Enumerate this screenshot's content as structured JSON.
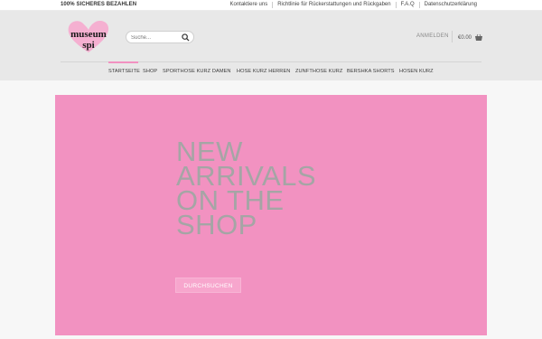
{
  "topbar": {
    "secure_text": "100% SICHERES BEZAHLEN",
    "links": [
      "Kontaktiere uns",
      "Richtlinie für Rückerstattungen und Rückgaben",
      "F.A.Q",
      "Datenschutzerklärung"
    ]
  },
  "header": {
    "logo_text_line1": "museum",
    "logo_text_line2": "spi",
    "search_placeholder": "Suche...",
    "login_label": "ANMELDEN",
    "cart_total": "€0.00",
    "brand_color": "#f292c1"
  },
  "nav": {
    "items": [
      "STARTSEITE",
      "SHOP",
      "SPORTHOSE KURZ DAMEN",
      "HOSE KURZ HERREN",
      "ZUNFTHOSE KURZ",
      "BERSHKA SHORTS",
      "HOSEN KURZ"
    ],
    "active": "STARTSEITE"
  },
  "hero": {
    "title_lines": [
      "NEW",
      "ARRIVALS",
      "ON THE",
      "SHOP"
    ],
    "button_label": "DURCHSUCHEN",
    "background_color": "#f292c1"
  }
}
